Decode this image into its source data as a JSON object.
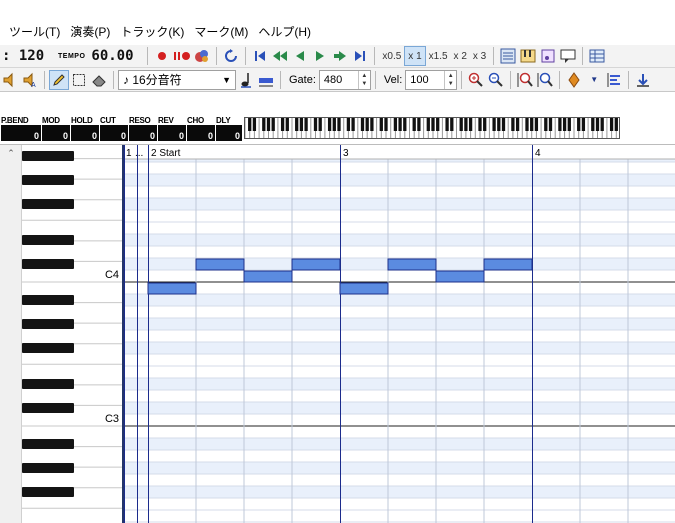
{
  "menubar": {
    "items": [
      "ツール(T)",
      "演奏(P)",
      "トラック(K)",
      "マーク(M)",
      "ヘルプ(H)"
    ]
  },
  "toolbar1": {
    "position": ": 120",
    "tempo_label": "TEMPO",
    "tempo_value": "60.00",
    "speed_options": [
      "x0.5",
      "x 1",
      "x1.5",
      "x 2",
      "x 3"
    ],
    "speed_active": "x 1"
  },
  "toolbar2": {
    "note_length": "♪ 16分音符",
    "gate_label": "Gate:",
    "gate_value": "480",
    "vel_label": "Vel:",
    "vel_value": "100"
  },
  "controllers": [
    {
      "label": "P.BEND",
      "value": "0"
    },
    {
      "label": "MOD",
      "value": "0"
    },
    {
      "label": "HOLD",
      "value": "0"
    },
    {
      "label": "CUT",
      "value": "0"
    },
    {
      "label": "RESO",
      "value": "0"
    },
    {
      "label": "REV",
      "value": "0"
    },
    {
      "label": "CHO",
      "value": "0"
    },
    {
      "label": "DLY",
      "value": "0"
    }
  ],
  "ruler": {
    "m1": "1",
    "ellipsis": "...",
    "m2": "2 Start",
    "m3": "3",
    "m4": "4"
  },
  "keyboard": {
    "octave_labels": [
      "C4",
      "C3"
    ]
  },
  "colors": {
    "note_fill": "#5b8be0",
    "note_border": "#1d2f8a",
    "bar_line": "#1c2c8c",
    "white_row": "#ffffff",
    "black_row": "#e9f0fb"
  }
}
